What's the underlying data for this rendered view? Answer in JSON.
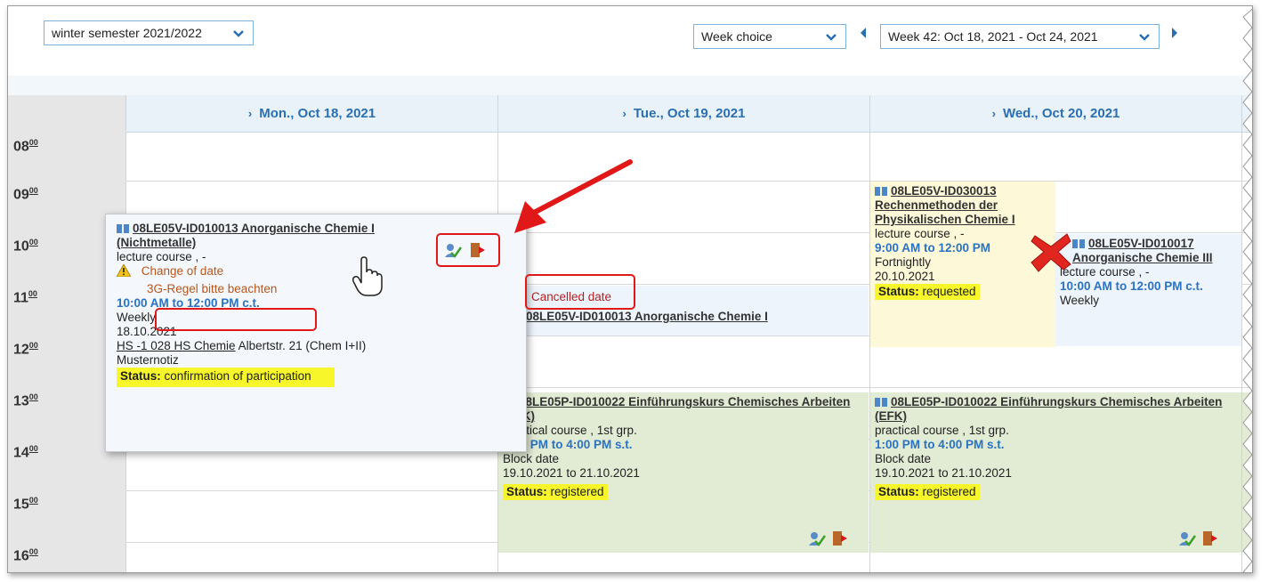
{
  "toolbar": {
    "semester": "winter semester 2021/2022",
    "week_choice": "Week choice",
    "week_range": "Week 42: Oct 18, 2021 - Oct 24, 2021"
  },
  "days": [
    {
      "label": "Mon., Oct 18, 2021"
    },
    {
      "label": "Tue., Oct 19, 2021"
    },
    {
      "label": "Wed., Oct 20, 2021"
    }
  ],
  "hours": [
    "08",
    "09",
    "10",
    "11",
    "12",
    "13",
    "14",
    "15",
    "16"
  ],
  "hour_suffix": "00",
  "popup": {
    "title": "08LE05V-ID010013 Anorganische Chemie I (Nichtmetalle)",
    "type": "lecture course , -",
    "change": "Change of date",
    "rule": "3G-Regel bitte beachten",
    "time": "10:00 AM to 12:00 PM c.t.",
    "rhythm": "Weekly",
    "date": "18.10.2021",
    "room": "HS -1 028 HS Chemie",
    "address": " Albertstr. 21 (Chem I+II)",
    "note": "Musternotiz",
    "status_label": "Status:",
    "status_value": " confirmation of participation"
  },
  "tue_cancel": {
    "cancelled": "Cancelled date",
    "title": "08LE05V-ID010013 Anorganische Chemie I"
  },
  "wed_event1": {
    "title": "08LE05V-ID030013 Rechenmethoden der Physikalischen Chemie I",
    "type": "lecture course , -",
    "time": "9:00 AM to 12:00 PM",
    "rhythm": "Fortnightly",
    "date": "20.10.2021",
    "status_label": "Status:",
    "status_value": " requested"
  },
  "wed_event2": {
    "title": "08LE05V-ID010017 Anorganische Chemie III",
    "type": "lecture course , -",
    "time": "10:00 AM to 12:00 PM c.t.",
    "rhythm": "Weekly"
  },
  "efk": {
    "title": "08LE05P-ID010022 Einführungskurs Chemisches Arbeiten (EFK)",
    "type": "practical course , 1st grp.",
    "time": "1:00 PM to 4:00 PM s.t.",
    "rhythm": "Block date",
    "date": "19.10.2021 to 21.10.2021",
    "status_label": "Status:",
    "status_value": " registered"
  },
  "colors": {
    "accent": "#2a72c2",
    "highlight": "#f6f62a",
    "annotation": "#e01818",
    "event_green": "#e2ebd4",
    "event_yellow": "#fdf8d8",
    "event_blue": "#eef4fb"
  }
}
